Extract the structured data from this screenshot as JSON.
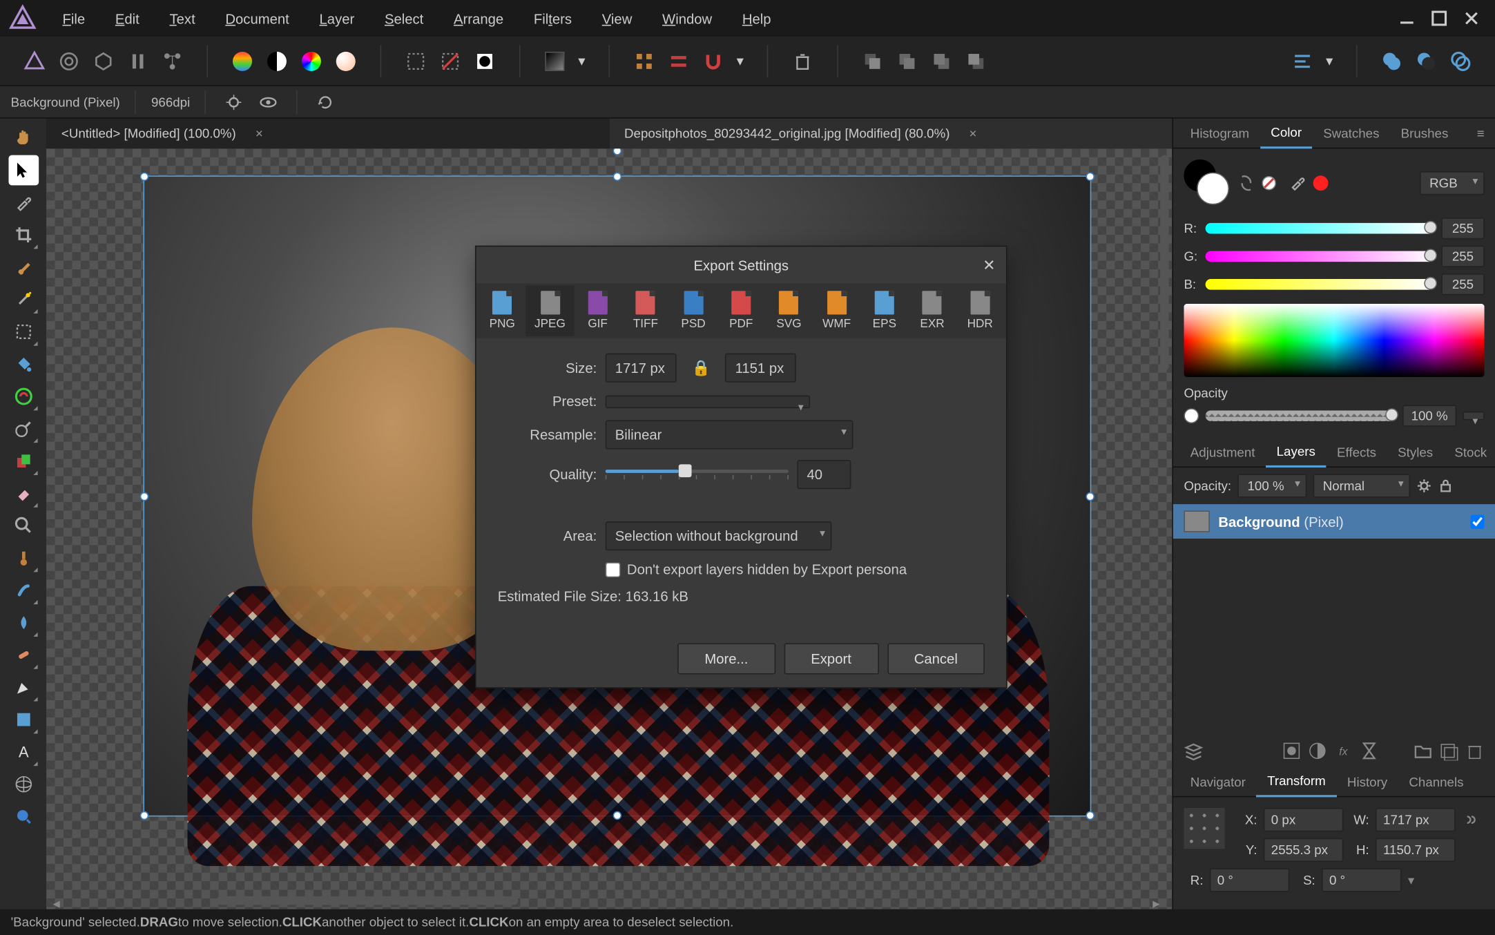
{
  "menu": {
    "items": [
      "File",
      "Edit",
      "Text",
      "Document",
      "Layer",
      "Select",
      "Arrange",
      "Filters",
      "View",
      "Window",
      "Help"
    ]
  },
  "context": {
    "layer_info": "Background (Pixel)",
    "dpi": "966dpi"
  },
  "tabs": [
    {
      "title": "<Untitled> [Modified] (100.0%)",
      "active": false
    },
    {
      "title": "Depositphotos_80293442_original.jpg [Modified] (80.0%)",
      "active": true
    }
  ],
  "dialog": {
    "title": "Export Settings",
    "formats": [
      "PNG",
      "JPEG",
      "GIF",
      "TIFF",
      "PSD",
      "PDF",
      "SVG",
      "WMF",
      "EPS",
      "EXR",
      "HDR"
    ],
    "format_colors": [
      "#5a9fd4",
      "#888",
      "#8a4aa8",
      "#d45a5a",
      "#3a7fc4",
      "#d44a4a",
      "#e08a2a",
      "#e08a2a",
      "#5a9fd4",
      "#888",
      "#888"
    ],
    "active_format_index": 1,
    "size_label": "Size:",
    "size_w": "1717 px",
    "size_h": "1151 px",
    "preset_label": "Preset:",
    "preset_value": "",
    "resample_label": "Resample:",
    "resample_value": "Bilinear",
    "quality_label": "Quality:",
    "quality_value": "40",
    "area_label": "Area:",
    "area_value": "Selection without background",
    "hide_layers_label": "Don't export layers hidden by Export persona",
    "est_label": "Estimated File Size:",
    "est_value": "163.16 kB",
    "btn_more": "More...",
    "btn_export": "Export",
    "btn_cancel": "Cancel"
  },
  "color_panel": {
    "tabs": [
      "Histogram",
      "Color",
      "Swatches",
      "Brushes"
    ],
    "active_tab": 1,
    "model": "RGB",
    "r_label": "R:",
    "r_val": "255",
    "g_label": "G:",
    "g_val": "255",
    "b_label": "B:",
    "b_val": "255",
    "opacity_label": "Opacity",
    "opacity_val": "100 %"
  },
  "layers_panel": {
    "tabs": [
      "Adjustment",
      "Layers",
      "Effects",
      "Styles",
      "Stock"
    ],
    "active_tab": 1,
    "opacity_label": "Opacity:",
    "opacity_val": "100 %",
    "blend": "Normal",
    "layer_name": "Background",
    "layer_type": "(Pixel)"
  },
  "nav_panel": {
    "tabs": [
      "Navigator",
      "Transform",
      "History",
      "Channels"
    ],
    "active_tab": 1,
    "x_label": "X:",
    "x_val": "0 px",
    "y_label": "Y:",
    "y_val": "2555.3 px",
    "w_label": "W:",
    "w_val": "1717 px",
    "h_label": "H:",
    "h_val": "1150.7 px",
    "r_label": "R:",
    "r_val": "0 °",
    "s_label": "S:",
    "s_val": "0 °"
  },
  "status": {
    "prefix": "'Background' selected. ",
    "drag": "DRAG",
    "drag_txt": " to move selection. ",
    "click1": "CLICK",
    "click1_txt": " another object to select it. ",
    "click2": "CLICK",
    "click2_txt": " on an empty area to deselect selection."
  }
}
